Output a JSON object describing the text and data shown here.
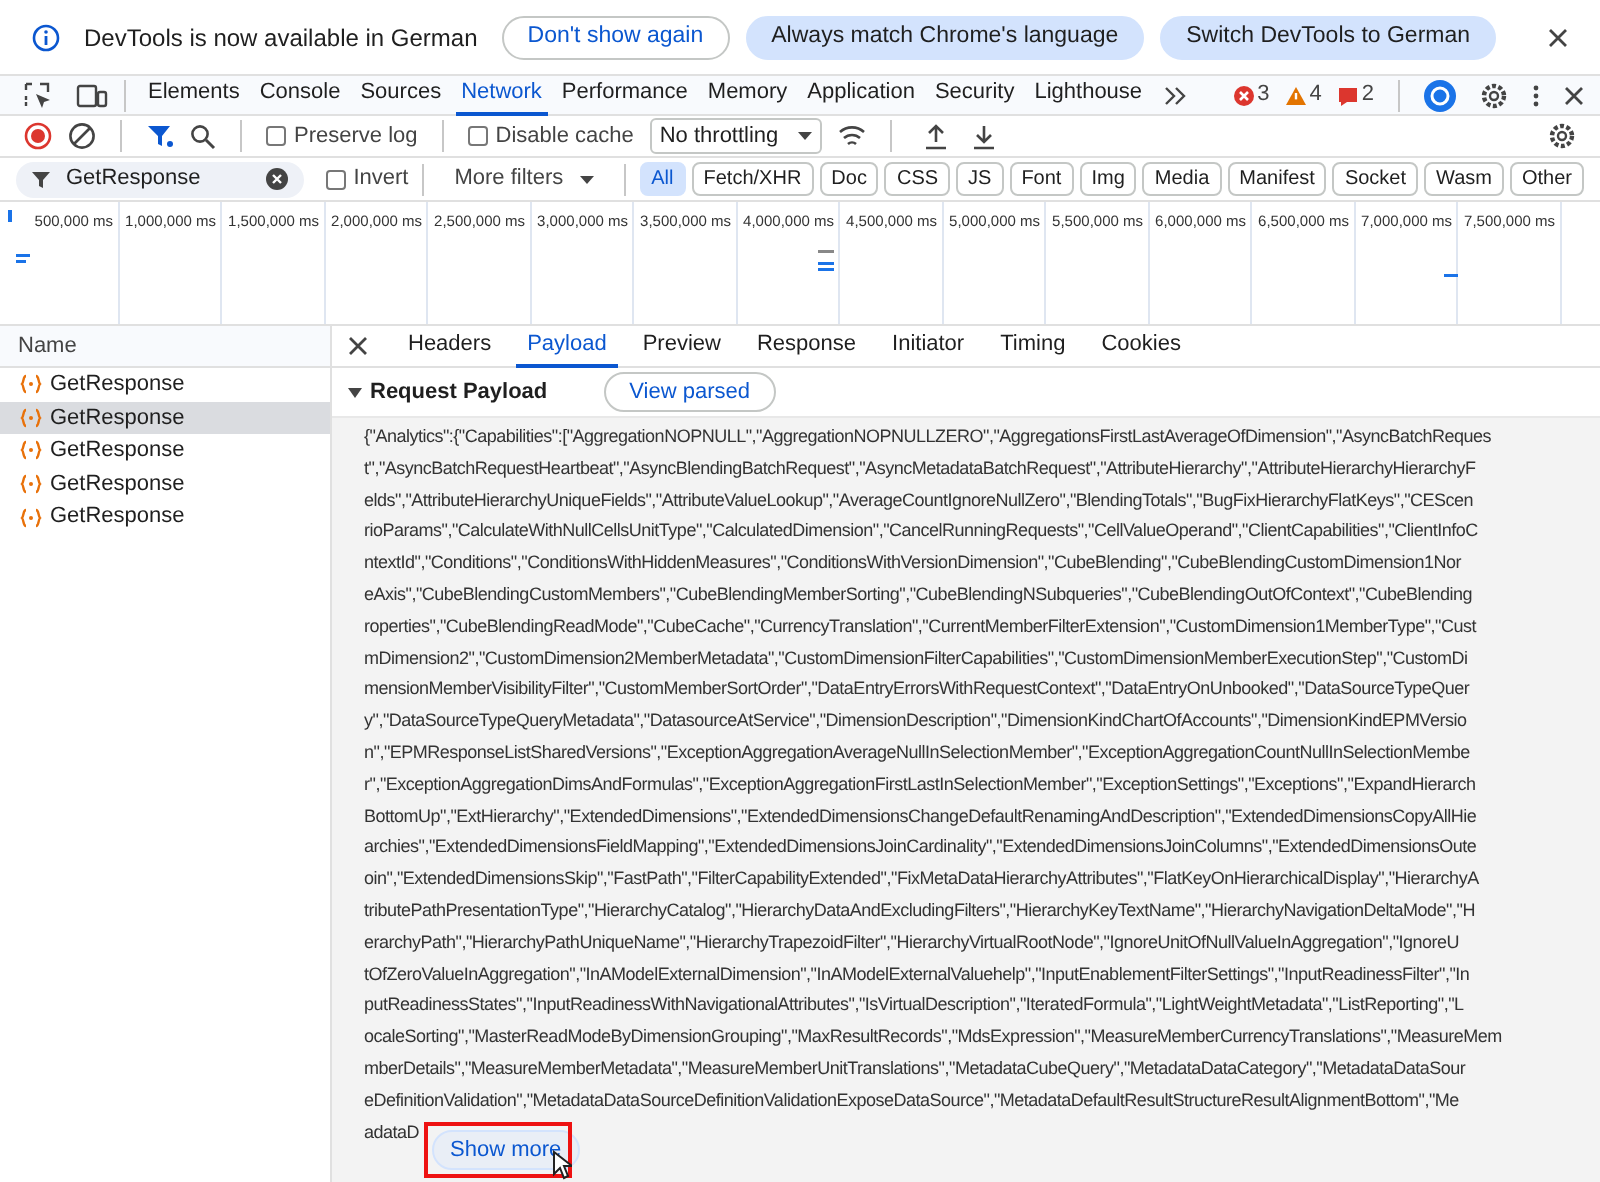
{
  "infobar": {
    "message": "DevTools is now available in German",
    "buttons": [
      {
        "label": "Don't show again",
        "kind": "outline"
      },
      {
        "label": "Always match Chrome's language",
        "kind": "tonal"
      },
      {
        "label": "Switch DevTools to German",
        "kind": "tonal"
      }
    ]
  },
  "main_tabs": [
    {
      "label": "Elements",
      "selected": false
    },
    {
      "label": "Console",
      "selected": false
    },
    {
      "label": "Sources",
      "selected": false
    },
    {
      "label": "Network",
      "selected": true
    },
    {
      "label": "Performance",
      "selected": false
    },
    {
      "label": "Memory",
      "selected": false
    },
    {
      "label": "Application",
      "selected": false
    },
    {
      "label": "Security",
      "selected": false
    },
    {
      "label": "Lighthouse",
      "selected": false
    }
  ],
  "issues": [
    {
      "kind": "error",
      "count": "3"
    },
    {
      "kind": "warning",
      "count": "4"
    },
    {
      "kind": "info",
      "count": "2"
    }
  ],
  "toolbar": {
    "preserve_log": {
      "label": "Preserve log",
      "checked": false
    },
    "disable_cache": {
      "label": "Disable cache",
      "checked": false
    },
    "throttling": "No throttling"
  },
  "filter": {
    "value": "GetResponse",
    "invert": {
      "label": "Invert",
      "checked": false
    },
    "more_filters": "More filters",
    "types": [
      {
        "label": "All",
        "selected": true
      },
      {
        "label": "Fetch/XHR",
        "selected": false
      },
      {
        "label": "Doc",
        "selected": false
      },
      {
        "label": "CSS",
        "selected": false
      },
      {
        "label": "JS",
        "selected": false
      },
      {
        "label": "Font",
        "selected": false
      },
      {
        "label": "Img",
        "selected": false
      },
      {
        "label": "Media",
        "selected": false
      },
      {
        "label": "Manifest",
        "selected": false
      },
      {
        "label": "Socket",
        "selected": false
      },
      {
        "label": "Wasm",
        "selected": false
      },
      {
        "label": "Other",
        "selected": false
      }
    ]
  },
  "timeline": {
    "ticks": [
      "500,000 ms",
      "1,000,000 ms",
      "1,500,000 ms",
      "2,000,000 ms",
      "2,500,000 ms",
      "3,000,000 ms",
      "3,500,000 ms",
      "4,000,000 ms",
      "4,500,000 ms",
      "5,000,000 ms",
      "5,500,000 ms",
      "6,000,000 ms",
      "6,500,000 ms",
      "7,000,000 ms",
      "7,500,000 ms"
    ]
  },
  "requests": {
    "column": "Name",
    "rows": [
      {
        "name": "GetResponse",
        "selected": false
      },
      {
        "name": "GetResponse",
        "selected": true
      },
      {
        "name": "GetResponse",
        "selected": false
      },
      {
        "name": "GetResponse",
        "selected": false
      },
      {
        "name": "GetResponse",
        "selected": false
      }
    ]
  },
  "detail": {
    "tabs": [
      {
        "label": "Headers",
        "selected": false
      },
      {
        "label": "Payload",
        "selected": true
      },
      {
        "label": "Preview",
        "selected": false
      },
      {
        "label": "Response",
        "selected": false
      },
      {
        "label": "Initiator",
        "selected": false
      },
      {
        "label": "Timing",
        "selected": false
      },
      {
        "label": "Cookies",
        "selected": false
      }
    ],
    "section": {
      "title": "Request Payload",
      "expanded": true,
      "button": "View parsed",
      "show_more": "Show more",
      "lines": [
        "{\"Analytics\":{\"Capabilities\":[\"AggregationNOPNULL\",\"AggregationNOPNULLZERO\",\"AggregationsFirstLastAverageOfDimension\",\"AsyncBatchReques",
        "t\",\"AsyncBatchRequestHeartbeat\",\"AsyncBlendingBatchRequest\",\"AsyncMetadataBatchRequest\",\"AttributeHierarchy\",\"AttributeHierarchyHierarchyF",
        "elds\",\"AttributeHierarchyUniqueFields\",\"AttributeValueLookup\",\"AverageCountIgnoreNullZero\",\"BlendingTotals\",\"BugFixHierarchyFlatKeys\",\"CEScen",
        "rioParams\",\"CalculateWithNullCellsUnitType\",\"CalculatedDimension\",\"CancelRunningRequests\",\"CellValueOperand\",\"ClientCapabilities\",\"ClientInfoC",
        "ntextId\",\"Conditions\",\"ConditionsWithHiddenMeasures\",\"ConditionsWithVersionDimension\",\"CubeBlending\",\"CubeBlendingCustomDimension1Nor",
        "eAxis\",\"CubeBlendingCustomMembers\",\"CubeBlendingMemberSorting\",\"CubeBlendingNSubqueries\",\"CubeBlendingOutOfContext\",\"CubeBlending",
        "roperties\",\"CubeBlendingReadMode\",\"CubeCache\",\"CurrencyTranslation\",\"CurrentMemberFilterExtension\",\"CustomDimension1MemberType\",\"Cust",
        "mDimension2\",\"CustomDimension2MemberMetadata\",\"CustomDimensionFilterCapabilities\",\"CustomDimensionMemberExecutionStep\",\"CustomDi",
        "mensionMemberVisibilityFilter\",\"CustomMemberSortOrder\",\"DataEntryErrorsWithRequestContext\",\"DataEntryOnUnbooked\",\"DataSourceTypeQuer",
        "y\",\"DataSourceTypeQueryMetadata\",\"DatasourceAtService\",\"DimensionDescription\",\"DimensionKindChartOfAccounts\",\"DimensionKindEPMVersio",
        "n\",\"EPMResponseListSharedVersions\",\"ExceptionAggregationAverageNullInSelectionMember\",\"ExceptionAggregationCountNullInSelectionMembe",
        "r\",\"ExceptionAggregationDimsAndFormulas\",\"ExceptionAggregationFirstLastInSelectionMember\",\"ExceptionSettings\",\"Exceptions\",\"ExpandHierarch",
        "BottomUp\",\"ExtHierarchy\",\"ExtendedDimensions\",\"ExtendedDimensionsChangeDefaultRenamingAndDescription\",\"ExtendedDimensionsCopyAllHie",
        "archies\",\"ExtendedDimensionsFieldMapping\",\"ExtendedDimensionsJoinCardinality\",\"ExtendedDimensionsJoinColumns\",\"ExtendedDimensionsOute",
        "oin\",\"ExtendedDimensionsSkip\",\"FastPath\",\"FilterCapabilityExtended\",\"FixMetaDataHierarchyAttributes\",\"FlatKeyOnHierarchicalDisplay\",\"HierarchyA",
        "tributePathPresentationType\",\"HierarchyCatalog\",\"HierarchyDataAndExcludingFilters\",\"HierarchyKeyTextName\",\"HierarchyNavigationDeltaMode\",\"H",
        "erarchyPath\",\"HierarchyPathUniqueName\",\"HierarchyTrapezoidFilter\",\"HierarchyVirtualRootNode\",\"IgnoreUnitOfNullValueInAggregation\",\"IgnoreU",
        "tOfZeroValueInAggregation\",\"InAModelExternalDimension\",\"InAModelExternalValuehelp\",\"InputEnablementFilterSettings\",\"InputReadinessFilter\",\"In",
        "putReadinessStates\",\"InputReadinessWithNavigationalAttributes\",\"IsVirtualDescription\",\"IteratedFormula\",\"LightWeightMetadata\",\"ListReporting\",\"L",
        "ocaleSorting\",\"MasterReadModeByDimensionGrouping\",\"MaxResultRecords\",\"MdsExpression\",\"MeasureMemberCurrencyTranslations\",\"MeasureMem",
        "mberDetails\",\"MeasureMemberMetadata\",\"MeasureMemberUnitTranslations\",\"MetadataCubeQuery\",\"MetadataDataCategory\",\"MetadataDataSour",
        "eDefinitionValidation\",\"MetadataDataSourceDefinitionValidationExposeDataSource\",\"MetadataDefaultResultStructureResultAlignmentBottom\",\"Me",
        "adataD"
      ]
    }
  }
}
